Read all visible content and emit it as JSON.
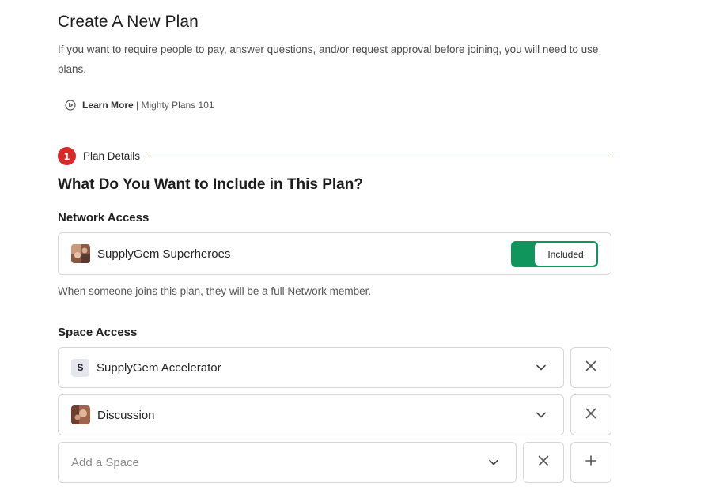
{
  "header": {
    "title": "Create A New Plan",
    "intro": "If you want to require people to pay, answer questions, and/or request approval before joining, you will need to use plans.",
    "learn_more_label": "Learn More",
    "learn_more_separator": " | ",
    "learn_more_link": "Mighty Plans 101"
  },
  "step": {
    "number": "1",
    "label": "Plan Details"
  },
  "section_title": "What Do You Want to Include in This Plan?",
  "network": {
    "heading": "Network Access",
    "name": "SupplyGem Superheroes",
    "toggle_label": "Included",
    "note": "When someone joins this plan, they will be a full Network member."
  },
  "spaces": {
    "heading": "Space Access",
    "items": [
      {
        "letter": "S",
        "name": "SupplyGem Accelerator"
      },
      {
        "name": "Discussion"
      }
    ],
    "add_placeholder": "Add a Space"
  },
  "colors": {
    "accent_red": "#d42a2a",
    "toggle_green": "#10965d",
    "border": "#d6d6d6"
  },
  "icons": [
    "play-circle-icon",
    "chevron-down-icon",
    "close-icon",
    "plus-icon"
  ]
}
